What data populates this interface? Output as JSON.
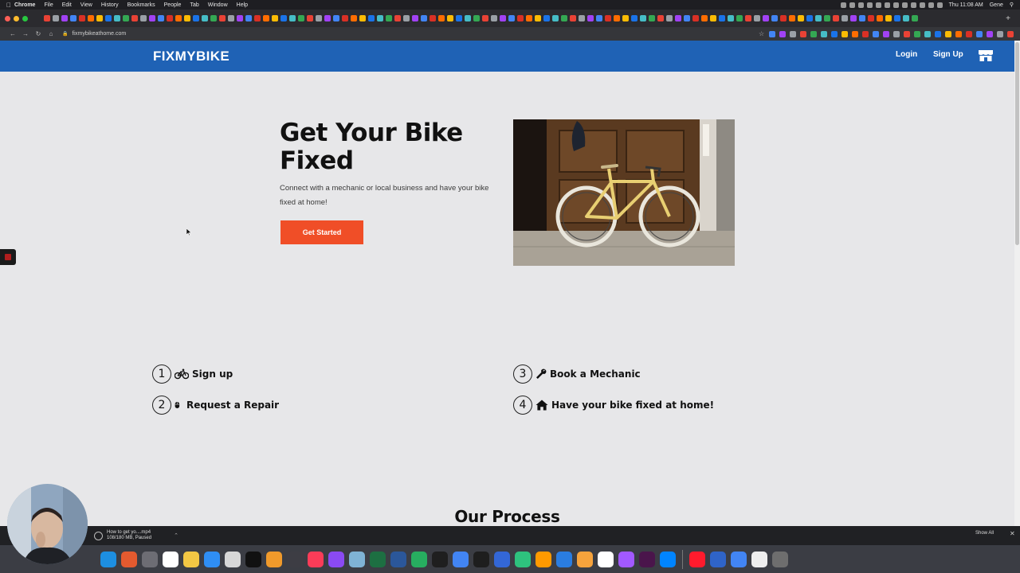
{
  "menubar": {
    "apple_icon": "apple-icon",
    "items": [
      "Chrome",
      "File",
      "Edit",
      "View",
      "History",
      "Bookmarks",
      "People",
      "Tab",
      "Window",
      "Help"
    ],
    "clock": "Thu 11:08 AM",
    "user": "Gene"
  },
  "browser": {
    "url": "fixmybikeathome.com",
    "back_icon": "back-arrow-icon",
    "forward_icon": "forward-arrow-icon",
    "reload_icon": "reload-icon",
    "home_icon": "home-icon",
    "lock_icon": "lock-icon",
    "star_icon": "star-icon"
  },
  "site": {
    "brand": "FIXMYBIKE",
    "nav": {
      "login": "Login",
      "signup": "Sign Up"
    },
    "store_icon": "store-icon",
    "brand_color": "#1f62b5",
    "accent_color": "#f04e27"
  },
  "hero": {
    "title": "Get Your Bike Fixed",
    "subtitle": "Connect with a mechanic or local business and have your bike fixed at home!",
    "cta": "Get Started",
    "image_alt": "yellow fixed-gear bicycle leaning against a wooden door"
  },
  "steps": [
    {
      "num": "1",
      "icon": "bicycle-icon",
      "label": "Sign up"
    },
    {
      "num": "2",
      "icon": "mouse-icon",
      "label": "Request a Repair"
    },
    {
      "num": "3",
      "icon": "wrench-icon",
      "label": "Book a Mechanic"
    },
    {
      "num": "4",
      "icon": "house-icon",
      "label": "Have your bike fixed at home!"
    }
  ],
  "section": {
    "title": "Our Process"
  },
  "downloads": {
    "file": "How to get yo....mp4",
    "status": "108/180 MB, Paused",
    "show_all": "Show All",
    "close_icon": "close-icon"
  }
}
